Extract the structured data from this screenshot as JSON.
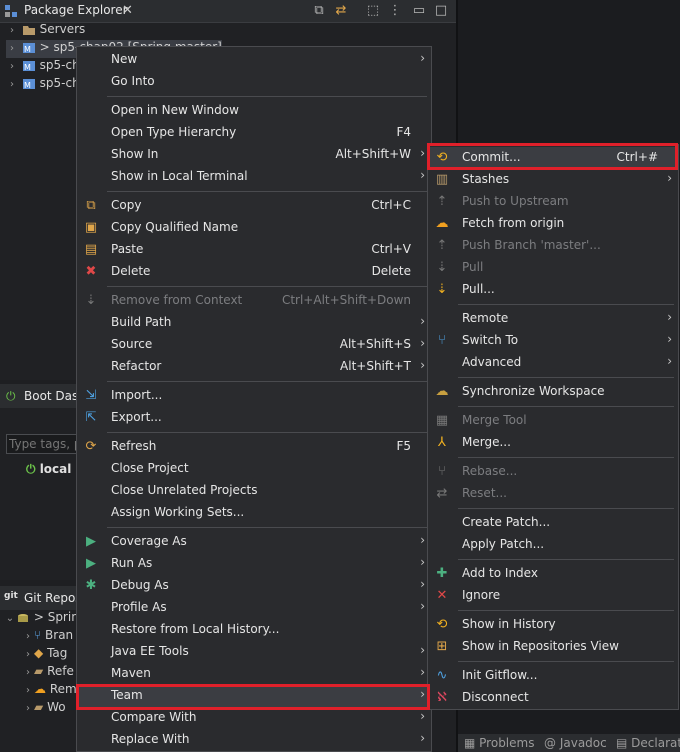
{
  "package_explorer": {
    "tab_title": "Package Explorer",
    "tree": [
      {
        "label": "Servers"
      },
      {
        "label": "> sp5-chap02 [Spring master]"
      },
      {
        "label": "sp5-ch"
      },
      {
        "label": "sp5-ch"
      }
    ]
  },
  "boot_dash": {
    "tab_title": "Boot Dash",
    "filter_placeholder": "Type tags, pr",
    "local_label": "local"
  },
  "git_repos": {
    "tab_title": "Git Repos",
    "tree": [
      "> Sprin",
      "Bran",
      "Tag",
      "Refe",
      "Rem",
      "Wo"
    ]
  },
  "bottom_tabs": [
    "Problems",
    "Javadoc",
    "Declarat"
  ],
  "context_menu": {
    "items": [
      {
        "label": "New",
        "submenu": true
      },
      {
        "label": "Go Into"
      },
      {
        "sep": true
      },
      {
        "label": "Open in New Window"
      },
      {
        "label": "Open Type Hierarchy",
        "shortcut": "F4"
      },
      {
        "label": "Show In",
        "shortcut": "Alt+Shift+W",
        "submenu": true
      },
      {
        "label": "Show in Local Terminal",
        "submenu": true
      },
      {
        "sep": true
      },
      {
        "label": "Copy",
        "shortcut": "Ctrl+C",
        "icon": "copy-icon"
      },
      {
        "label": "Copy Qualified Name",
        "icon": "copy-qualified-icon"
      },
      {
        "label": "Paste",
        "shortcut": "Ctrl+V",
        "icon": "paste-icon"
      },
      {
        "label": "Delete",
        "shortcut": "Delete",
        "icon": "delete-icon"
      },
      {
        "sep": true
      },
      {
        "label": "Remove from Context",
        "shortcut": "Ctrl+Alt+Shift+Down",
        "disabled": true,
        "icon": "remove-context-icon"
      },
      {
        "label": "Build Path",
        "submenu": true
      },
      {
        "label": "Source",
        "shortcut": "Alt+Shift+S",
        "submenu": true
      },
      {
        "label": "Refactor",
        "shortcut": "Alt+Shift+T",
        "submenu": true
      },
      {
        "sep": true
      },
      {
        "label": "Import...",
        "icon": "import-icon"
      },
      {
        "label": "Export...",
        "icon": "export-icon"
      },
      {
        "sep": true
      },
      {
        "label": "Refresh",
        "shortcut": "F5",
        "icon": "refresh-icon"
      },
      {
        "label": "Close Project"
      },
      {
        "label": "Close Unrelated Projects"
      },
      {
        "label": "Assign Working Sets..."
      },
      {
        "sep": true
      },
      {
        "label": "Coverage As",
        "submenu": true,
        "icon": "coverage-icon"
      },
      {
        "label": "Run As",
        "submenu": true,
        "icon": "run-icon"
      },
      {
        "label": "Debug As",
        "submenu": true,
        "icon": "debug-icon"
      },
      {
        "label": "Profile As",
        "submenu": true
      },
      {
        "label": "Restore from Local History..."
      },
      {
        "label": "Java EE Tools",
        "submenu": true
      },
      {
        "label": "Maven",
        "submenu": true
      },
      {
        "label": "Team",
        "submenu": true,
        "highlight": true
      },
      {
        "label": "Compare With",
        "submenu": true
      },
      {
        "label": "Replace With",
        "submenu": true
      }
    ]
  },
  "team_menu": {
    "items": [
      {
        "label": "Commit...",
        "shortcut": "Ctrl+#",
        "icon": "commit-icon",
        "highlight": true
      },
      {
        "label": "Stashes",
        "submenu": true,
        "icon": "stashes-icon"
      },
      {
        "label": "Push to Upstream",
        "disabled": true,
        "icon": "push-upstream-icon"
      },
      {
        "label": "Fetch from origin",
        "icon": "fetch-icon"
      },
      {
        "label": "Push Branch 'master'...",
        "disabled": true,
        "icon": "push-branch-icon"
      },
      {
        "label": "Pull",
        "disabled": true,
        "icon": "pull-disabled-icon"
      },
      {
        "label": "Pull...",
        "icon": "pull-icon"
      },
      {
        "sep": true
      },
      {
        "label": "Remote",
        "submenu": true
      },
      {
        "label": "Switch To",
        "submenu": true,
        "icon": "switch-branch-icon"
      },
      {
        "label": "Advanced",
        "submenu": true
      },
      {
        "sep": true
      },
      {
        "label": "Synchronize Workspace",
        "icon": "synchronize-icon"
      },
      {
        "sep": true
      },
      {
        "label": "Merge Tool",
        "disabled": true,
        "icon": "merge-tool-icon"
      },
      {
        "label": "Merge...",
        "icon": "merge-icon"
      },
      {
        "sep": true
      },
      {
        "label": "Rebase...",
        "disabled": true,
        "icon": "rebase-icon"
      },
      {
        "label": "Reset...",
        "disabled": true,
        "icon": "reset-icon"
      },
      {
        "sep": true
      },
      {
        "label": "Create Patch..."
      },
      {
        "label": "Apply Patch..."
      },
      {
        "sep": true
      },
      {
        "label": "Add to Index",
        "icon": "add-index-icon"
      },
      {
        "label": "Ignore",
        "icon": "ignore-icon"
      },
      {
        "sep": true
      },
      {
        "label": "Show in History",
        "icon": "history-icon"
      },
      {
        "label": "Show in Repositories View",
        "icon": "repositories-icon"
      },
      {
        "sep": true
      },
      {
        "label": "Init Gitflow...",
        "icon": "gitflow-icon"
      },
      {
        "label": "Disconnect",
        "icon": "disconnect-icon"
      }
    ]
  },
  "colors": {
    "highlight_border": "#e0202a",
    "menu_bg": "#2a2b2e"
  }
}
